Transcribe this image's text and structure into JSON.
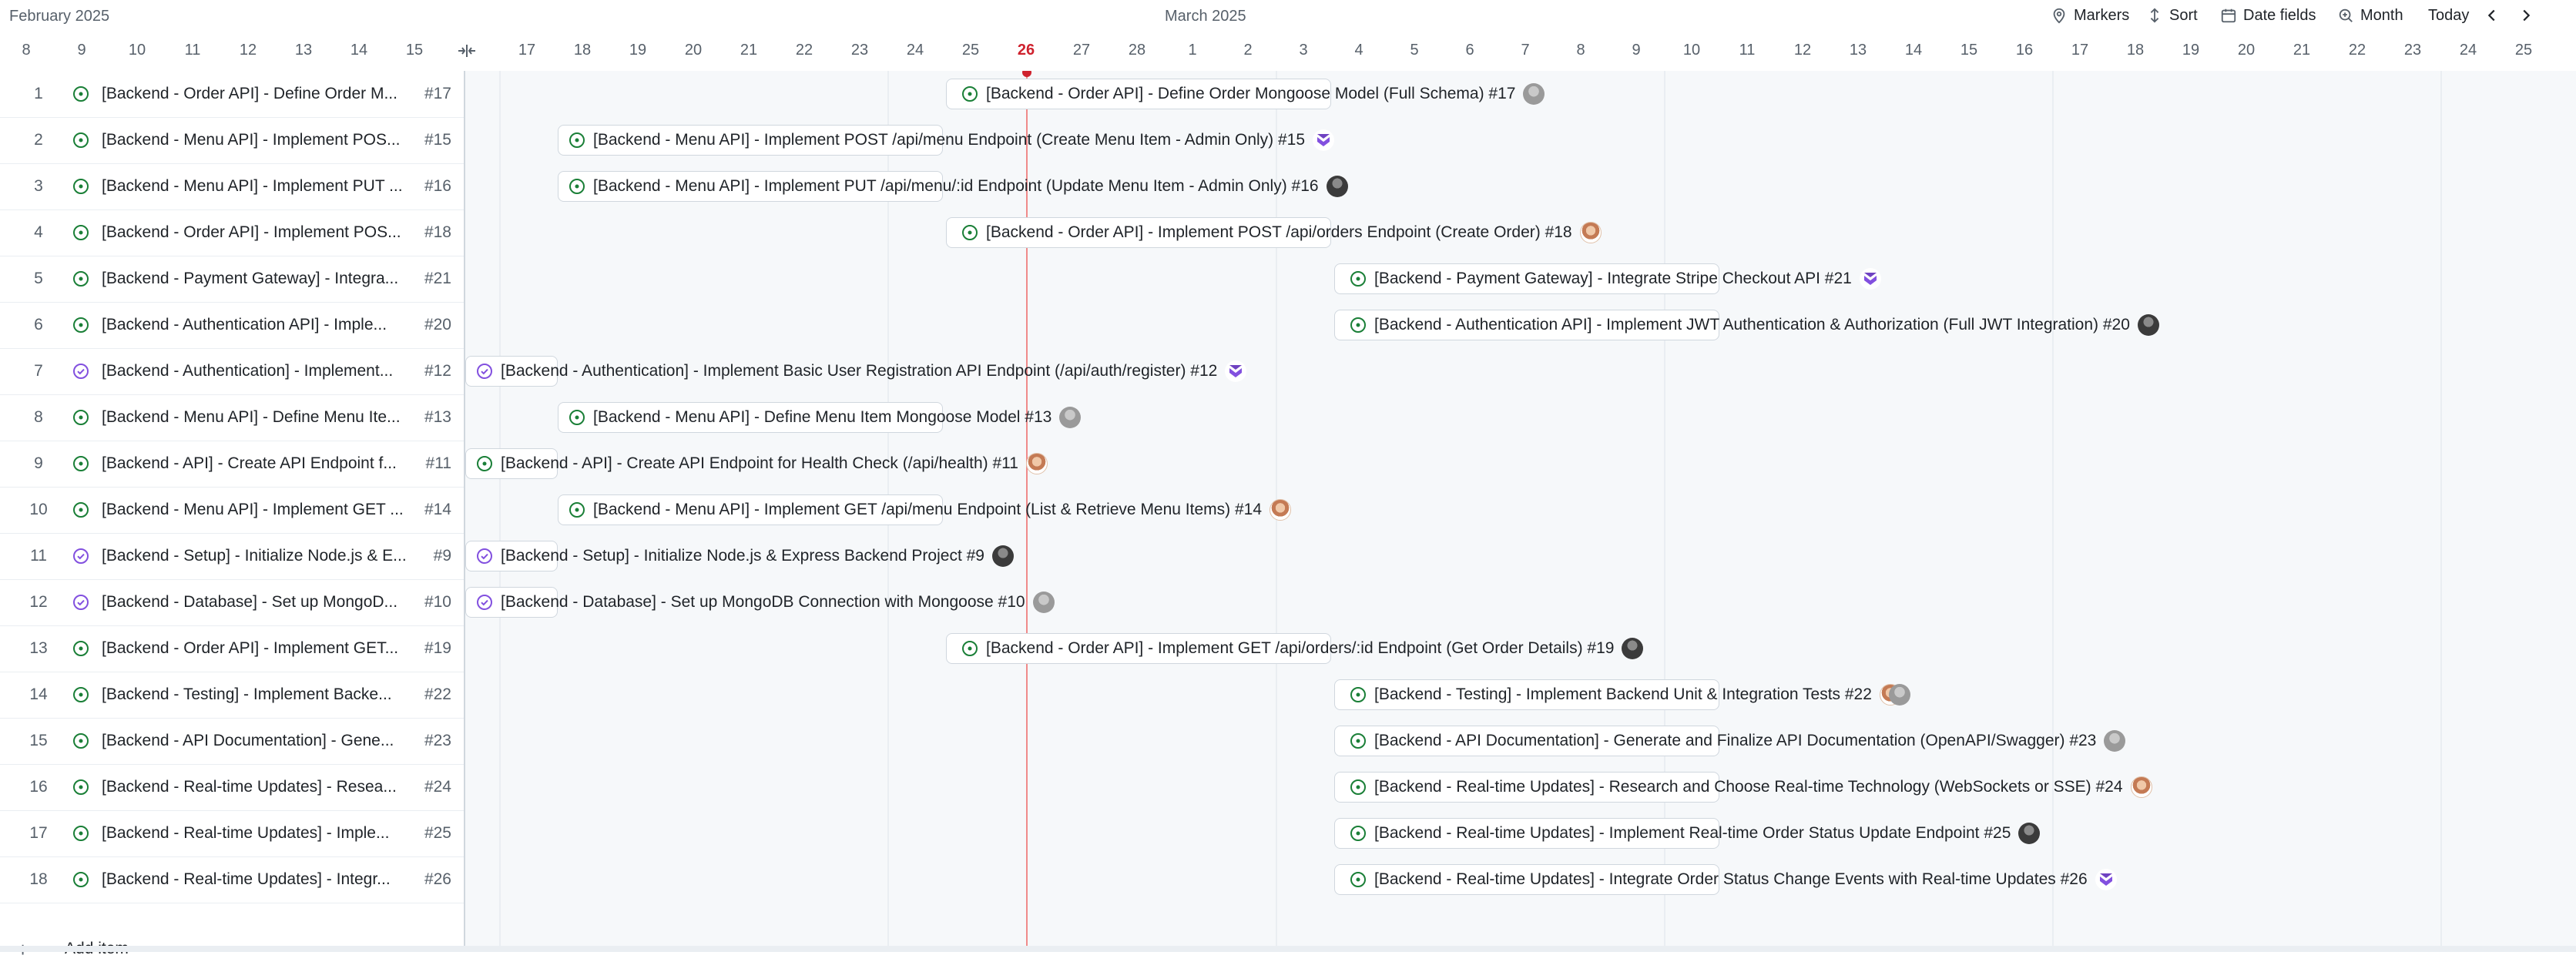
{
  "header": {
    "month_left": "February 2025",
    "month_center": "March 2025",
    "toolbar": {
      "markers": "Markers",
      "sort": "Sort",
      "date_fields": "Date fields",
      "zoom": "Month",
      "today": "Today"
    },
    "ticks": [
      "8",
      "9",
      "10",
      "11",
      "12",
      "13",
      "14",
      "15",
      "17",
      "18",
      "19",
      "20",
      "21",
      "22",
      "23",
      "24",
      "25",
      "26",
      "27",
      "28",
      "1",
      "2",
      "3",
      "4",
      "5",
      "6",
      "7",
      "8",
      "9",
      "10",
      "11",
      "12",
      "13",
      "14",
      "15",
      "16",
      "17",
      "18",
      "19",
      "20",
      "21",
      "22",
      "23",
      "24",
      "25"
    ],
    "today_label": "26"
  },
  "rows": [
    {
      "num": "1",
      "title": "[Backend - Order API] - Define Order M...",
      "number": "#17",
      "status": "open",
      "bar_text": "[Backend - Order API] - Define Order Mongoose Model (Full Schema) #17",
      "avatar": "gray"
    },
    {
      "num": "2",
      "title": "[Backend - Menu API] - Implement POS...",
      "number": "#15",
      "status": "open",
      "bar_text": "[Backend - Menu API] - Implement POST /api/menu Endpoint (Create Menu Item - Admin Only) #15",
      "avatar": "bot"
    },
    {
      "num": "3",
      "title": "[Backend - Menu API] - Implement PUT ...",
      "number": "#16",
      "status": "open",
      "bar_text": "[Backend - Menu API] - Implement PUT /api/menu/:id Endpoint (Update Menu Item - Admin Only) #16",
      "avatar": "dark"
    },
    {
      "num": "4",
      "title": "[Backend - Order API] - Implement POS...",
      "number": "#18",
      "status": "open",
      "bar_text": "[Backend - Order API] - Implement POST /api/orders Endpoint (Create Order) #18",
      "avatar": "face"
    },
    {
      "num": "5",
      "title": "[Backend - Payment Gateway] - Integra...",
      "number": "#21",
      "status": "open",
      "bar_text": "[Backend - Payment Gateway] - Integrate Stripe Checkout API #21",
      "avatar": "bot"
    },
    {
      "num": "6",
      "title": "[Backend - Authentication API] - Imple...",
      "number": "#20",
      "status": "open",
      "bar_text": "[Backend - Authentication API] - Implement JWT Authentication & Authorization (Full JWT Integration) #20",
      "avatar": "dark"
    },
    {
      "num": "7",
      "title": "[Backend - Authentication] - Implement...",
      "number": "#12",
      "status": "done",
      "bar_text": "[Backend - Authentication] - Implement Basic User Registration API Endpoint (/api/auth/register) #12",
      "avatar": "bot"
    },
    {
      "num": "8",
      "title": "[Backend - Menu API] - Define Menu Ite...",
      "number": "#13",
      "status": "open",
      "bar_text": "[Backend - Menu API] - Define Menu Item Mongoose Model #13",
      "avatar": "gray"
    },
    {
      "num": "9",
      "title": "[Backend - API] - Create API Endpoint f...",
      "number": "#11",
      "status": "open",
      "bar_text": "[Backend - API] - Create API Endpoint for Health Check (/api/health) #11",
      "avatar": "face"
    },
    {
      "num": "10",
      "title": "[Backend - Menu API] - Implement GET ...",
      "number": "#14",
      "status": "open",
      "bar_text": "[Backend - Menu API] - Implement GET /api/menu Endpoint (List & Retrieve Menu Items) #14",
      "avatar": "face"
    },
    {
      "num": "11",
      "title": "[Backend - Setup] - Initialize Node.js & E...",
      "number": "#9",
      "status": "done",
      "bar_text": "[Backend - Setup] - Initialize Node.js & Express Backend Project #9",
      "avatar": "dark"
    },
    {
      "num": "12",
      "title": "[Backend - Database] - Set up MongoD...",
      "number": "#10",
      "status": "done",
      "bar_text": "[Backend - Database] - Set up MongoDB Connection with Mongoose #10",
      "avatar": "gray"
    },
    {
      "num": "13",
      "title": "[Backend - Order API] - Implement GET...",
      "number": "#19",
      "status": "open",
      "bar_text": "[Backend - Order API] - Implement GET /api/orders/:id Endpoint (Get Order Details) #19",
      "avatar": "dark"
    },
    {
      "num": "14",
      "title": "[Backend - Testing] - Implement Backe...",
      "number": "#22",
      "status": "open",
      "bar_text": "[Backend - Testing] - Implement Backend Unit & Integration Tests #22",
      "avatar": "pair"
    },
    {
      "num": "15",
      "title": "[Backend - API Documentation] - Gene...",
      "number": "#23",
      "status": "open",
      "bar_text": "[Backend - API Documentation] - Generate and Finalize API Documentation (OpenAPI/Swagger) #23",
      "avatar": "gray"
    },
    {
      "num": "16",
      "title": "[Backend - Real-time Updates] - Resea...",
      "number": "#24",
      "status": "open",
      "bar_text": "[Backend - Real-time Updates] - Research and Choose Real-time Technology (WebSockets or SSE) #24",
      "avatar": "face"
    },
    {
      "num": "17",
      "title": "[Backend - Real-time Updates] - Imple...",
      "number": "#25",
      "status": "open",
      "bar_text": "[Backend - Real-time Updates] - Implement Real-time Order Status Update Endpoint #25",
      "avatar": "dark"
    },
    {
      "num": "18",
      "title": "[Backend - Real-time Updates] - Integr...",
      "number": "#26",
      "status": "open",
      "bar_text": "[Backend - Real-time Updates] - Integrate Order Status Change Events with Real-time Updates #26",
      "avatar": "bot"
    }
  ],
  "add_item_label": "Add item",
  "colors": {
    "open_status": "#1a7f37",
    "done_status": "#8250df",
    "today": "#cf222e"
  }
}
